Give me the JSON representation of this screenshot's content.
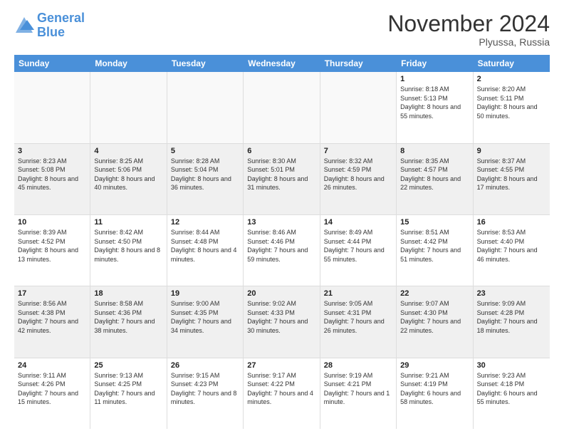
{
  "logo": {
    "line1": "General",
    "line2": "Blue"
  },
  "header": {
    "title": "November 2024",
    "location": "Plyussa, Russia"
  },
  "days_of_week": [
    "Sunday",
    "Monday",
    "Tuesday",
    "Wednesday",
    "Thursday",
    "Friday",
    "Saturday"
  ],
  "weeks": [
    [
      {
        "day": "",
        "info": "",
        "empty": true
      },
      {
        "day": "",
        "info": "",
        "empty": true
      },
      {
        "day": "",
        "info": "",
        "empty": true
      },
      {
        "day": "",
        "info": "",
        "empty": true
      },
      {
        "day": "",
        "info": "",
        "empty": true
      },
      {
        "day": "1",
        "info": "Sunrise: 8:18 AM\nSunset: 5:13 PM\nDaylight: 8 hours and 55 minutes.",
        "empty": false
      },
      {
        "day": "2",
        "info": "Sunrise: 8:20 AM\nSunset: 5:11 PM\nDaylight: 8 hours and 50 minutes.",
        "empty": false
      }
    ],
    [
      {
        "day": "3",
        "info": "Sunrise: 8:23 AM\nSunset: 5:08 PM\nDaylight: 8 hours and 45 minutes.",
        "empty": false
      },
      {
        "day": "4",
        "info": "Sunrise: 8:25 AM\nSunset: 5:06 PM\nDaylight: 8 hours and 40 minutes.",
        "empty": false
      },
      {
        "day": "5",
        "info": "Sunrise: 8:28 AM\nSunset: 5:04 PM\nDaylight: 8 hours and 36 minutes.",
        "empty": false
      },
      {
        "day": "6",
        "info": "Sunrise: 8:30 AM\nSunset: 5:01 PM\nDaylight: 8 hours and 31 minutes.",
        "empty": false
      },
      {
        "day": "7",
        "info": "Sunrise: 8:32 AM\nSunset: 4:59 PM\nDaylight: 8 hours and 26 minutes.",
        "empty": false
      },
      {
        "day": "8",
        "info": "Sunrise: 8:35 AM\nSunset: 4:57 PM\nDaylight: 8 hours and 22 minutes.",
        "empty": false
      },
      {
        "day": "9",
        "info": "Sunrise: 8:37 AM\nSunset: 4:55 PM\nDaylight: 8 hours and 17 minutes.",
        "empty": false
      }
    ],
    [
      {
        "day": "10",
        "info": "Sunrise: 8:39 AM\nSunset: 4:52 PM\nDaylight: 8 hours and 13 minutes.",
        "empty": false
      },
      {
        "day": "11",
        "info": "Sunrise: 8:42 AM\nSunset: 4:50 PM\nDaylight: 8 hours and 8 minutes.",
        "empty": false
      },
      {
        "day": "12",
        "info": "Sunrise: 8:44 AM\nSunset: 4:48 PM\nDaylight: 8 hours and 4 minutes.",
        "empty": false
      },
      {
        "day": "13",
        "info": "Sunrise: 8:46 AM\nSunset: 4:46 PM\nDaylight: 7 hours and 59 minutes.",
        "empty": false
      },
      {
        "day": "14",
        "info": "Sunrise: 8:49 AM\nSunset: 4:44 PM\nDaylight: 7 hours and 55 minutes.",
        "empty": false
      },
      {
        "day": "15",
        "info": "Sunrise: 8:51 AM\nSunset: 4:42 PM\nDaylight: 7 hours and 51 minutes.",
        "empty": false
      },
      {
        "day": "16",
        "info": "Sunrise: 8:53 AM\nSunset: 4:40 PM\nDaylight: 7 hours and 46 minutes.",
        "empty": false
      }
    ],
    [
      {
        "day": "17",
        "info": "Sunrise: 8:56 AM\nSunset: 4:38 PM\nDaylight: 7 hours and 42 minutes.",
        "empty": false
      },
      {
        "day": "18",
        "info": "Sunrise: 8:58 AM\nSunset: 4:36 PM\nDaylight: 7 hours and 38 minutes.",
        "empty": false
      },
      {
        "day": "19",
        "info": "Sunrise: 9:00 AM\nSunset: 4:35 PM\nDaylight: 7 hours and 34 minutes.",
        "empty": false
      },
      {
        "day": "20",
        "info": "Sunrise: 9:02 AM\nSunset: 4:33 PM\nDaylight: 7 hours and 30 minutes.",
        "empty": false
      },
      {
        "day": "21",
        "info": "Sunrise: 9:05 AM\nSunset: 4:31 PM\nDaylight: 7 hours and 26 minutes.",
        "empty": false
      },
      {
        "day": "22",
        "info": "Sunrise: 9:07 AM\nSunset: 4:30 PM\nDaylight: 7 hours and 22 minutes.",
        "empty": false
      },
      {
        "day": "23",
        "info": "Sunrise: 9:09 AM\nSunset: 4:28 PM\nDaylight: 7 hours and 18 minutes.",
        "empty": false
      }
    ],
    [
      {
        "day": "24",
        "info": "Sunrise: 9:11 AM\nSunset: 4:26 PM\nDaylight: 7 hours and 15 minutes.",
        "empty": false
      },
      {
        "day": "25",
        "info": "Sunrise: 9:13 AM\nSunset: 4:25 PM\nDaylight: 7 hours and 11 minutes.",
        "empty": false
      },
      {
        "day": "26",
        "info": "Sunrise: 9:15 AM\nSunset: 4:23 PM\nDaylight: 7 hours and 8 minutes.",
        "empty": false
      },
      {
        "day": "27",
        "info": "Sunrise: 9:17 AM\nSunset: 4:22 PM\nDaylight: 7 hours and 4 minutes.",
        "empty": false
      },
      {
        "day": "28",
        "info": "Sunrise: 9:19 AM\nSunset: 4:21 PM\nDaylight: 7 hours and 1 minute.",
        "empty": false
      },
      {
        "day": "29",
        "info": "Sunrise: 9:21 AM\nSunset: 4:19 PM\nDaylight: 6 hours and 58 minutes.",
        "empty": false
      },
      {
        "day": "30",
        "info": "Sunrise: 9:23 AM\nSunset: 4:18 PM\nDaylight: 6 hours and 55 minutes.",
        "empty": false
      }
    ]
  ]
}
